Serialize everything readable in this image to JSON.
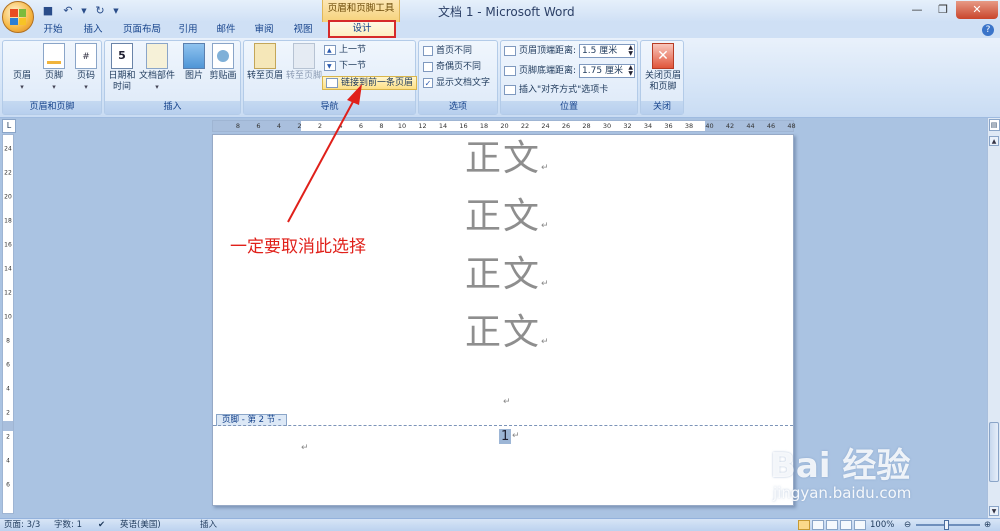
{
  "app": {
    "title": "文档 1 - Microsoft Word",
    "context_tool": "页眉和页脚工具"
  },
  "tabs": [
    {
      "label": "开始"
    },
    {
      "label": "插入"
    },
    {
      "label": "页面布局"
    },
    {
      "label": "引用"
    },
    {
      "label": "邮件"
    },
    {
      "label": "审阅"
    },
    {
      "label": "视图"
    },
    {
      "label": "设计",
      "active": true
    }
  ],
  "ribbon": {
    "group_header_footer": {
      "label": "页眉和页脚",
      "header": "页眉",
      "footer": "页脚",
      "page_number": "页码"
    },
    "group_insert": {
      "label": "插入",
      "date_time_1": "日期和",
      "date_time_2": "时间",
      "quick_parts": "文档部件",
      "picture": "图片",
      "clip_art": "剪贴画",
      "cal_glyph": "5"
    },
    "group_navigation": {
      "label": "导航",
      "goto_header": "转至页眉",
      "goto_footer": "转至页脚",
      "prev_section": "上一节",
      "next_section": "下一节",
      "link_to_previous": "链接到前一条页眉"
    },
    "group_options": {
      "label": "选项",
      "different_first": "首页不同",
      "different_odd_even": "奇偶页不同",
      "show_document_text": "显示文档文字",
      "show_document_text_checked": true
    },
    "group_position": {
      "label": "位置",
      "header_from_top_label": "页眉顶端距离:",
      "header_from_top_value": "1.5 厘米",
      "footer_from_bottom_label": "页脚底端距离:",
      "footer_from_bottom_value": "1.75 厘米",
      "insert_alignment_tab": "插入\"对齐方式\"选项卡"
    },
    "group_close": {
      "label": "关闭",
      "close_1": "关闭页眉",
      "close_2": "和页脚"
    }
  },
  "ruler": {
    "h_numbers": [
      "8",
      "6",
      "4",
      "2",
      "2",
      "4",
      "6",
      "8",
      "10",
      "12",
      "14",
      "16",
      "18",
      "20",
      "22",
      "24",
      "26",
      "28",
      "30",
      "32",
      "34",
      "36",
      "38",
      "40",
      "42",
      "44",
      "46",
      "48"
    ],
    "v_numbers": [
      "24",
      "22",
      "20",
      "18",
      "16",
      "14",
      "12",
      "10",
      "8",
      "6",
      "4",
      "2",
      "2",
      "4",
      "6"
    ]
  },
  "document": {
    "body_lines": [
      "正文",
      "正文",
      "正文",
      "正文"
    ],
    "paragraph_mark": "↵",
    "footer_tab": "页脚 - 第 2 节 -",
    "page_number": "1"
  },
  "annotation": {
    "text": "一定要取消此选择",
    "color": "#e0201a"
  },
  "statusbar": {
    "page": "页面: 3/3",
    "words": "字数: 1",
    "language": "英语(美国)",
    "mode": "插入",
    "zoom": "100%"
  },
  "watermark": {
    "logo": "Bai 经验",
    "url": "jingyan.baidu.com"
  }
}
